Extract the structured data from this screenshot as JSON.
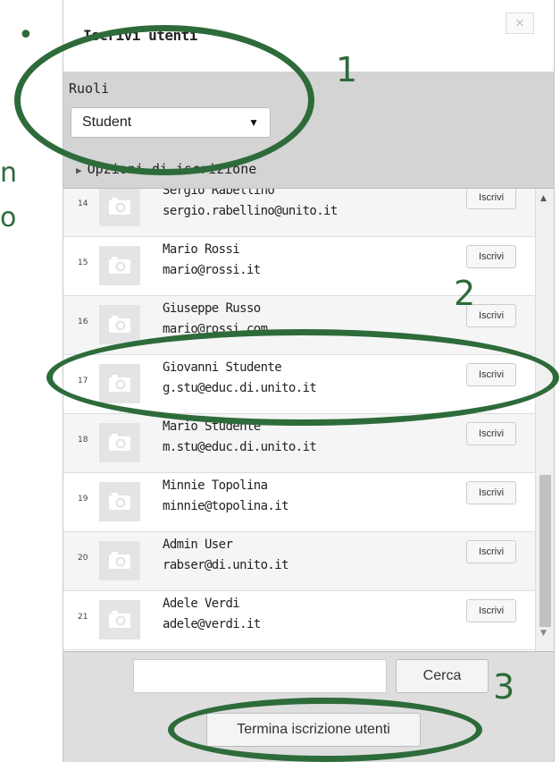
{
  "dialog": {
    "title": "Iscrivi utenti",
    "close_label": "×"
  },
  "options": {
    "roles_label": "Ruoli",
    "role_selected": "Student",
    "enrolment_options_label": "Opzioni di iscrizione"
  },
  "users": [
    {
      "num": "14",
      "name": "Sergio Rabellino",
      "email": "sergio.rabellino@unito.it",
      "button": "Iscrivi"
    },
    {
      "num": "15",
      "name": "Mario Rossi",
      "email": "mario@rossi.it",
      "button": "Iscrivi"
    },
    {
      "num": "16",
      "name": "Giuseppe Russo",
      "email": "mario@rossi.com",
      "button": "Iscrivi"
    },
    {
      "num": "17",
      "name": "Giovanni Studente",
      "email": "g.stu@educ.di.unito.it",
      "button": "Iscrivi"
    },
    {
      "num": "18",
      "name": "Mario Studente",
      "email": "m.stu@educ.di.unito.it",
      "button": "Iscrivi"
    },
    {
      "num": "19",
      "name": "Minnie Topolina",
      "email": "minnie@topolina.it",
      "button": "Iscrivi"
    },
    {
      "num": "20",
      "name": "Admin User",
      "email": "rabser@di.unito.it",
      "button": "Iscrivi"
    },
    {
      "num": "21",
      "name": "Adele Verdi",
      "email": "adele@verdi.it",
      "button": "Iscrivi"
    }
  ],
  "footer": {
    "search_value": "",
    "search_button": "Cerca",
    "finish_button": "Termina iscrizione utenti"
  },
  "annotations": {
    "label_1": "1",
    "label_2": "2",
    "label_3": "3",
    "color": "#2e6b3a"
  },
  "background_fragments": {
    "dot": "•",
    "n": "n",
    "o": "o"
  },
  "icons": {
    "avatar": "camera-icon",
    "dropdown": "caret-down-icon",
    "enrol_options": "triangle-right-icon"
  }
}
